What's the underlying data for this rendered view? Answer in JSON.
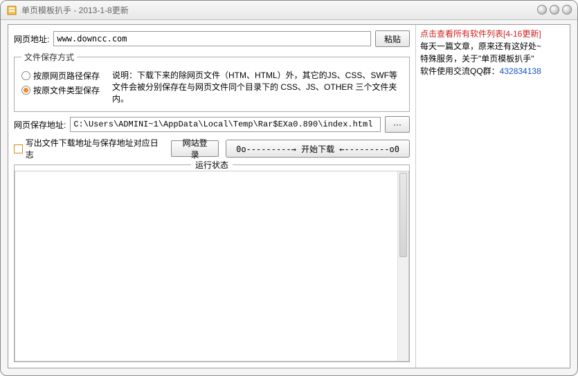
{
  "window": {
    "title": "单页模板扒手 - 2013-1-8更新"
  },
  "main": {
    "url_label": "网页地址:",
    "url_value": "www.downcc.com",
    "paste_btn": "粘贴",
    "save_group_title": "文件保存方式",
    "radio1": "按原网页路径保存",
    "radio2": "按原文件类型保存",
    "save_desc": "说明：下载下来的除网页文件（HTM、HTML）外，其它的JS、CSS、SWF等文件会被分别保存在与网页文件同个目录下的 CSS、JS、OTHER 三个文件夹内。",
    "savepath_label": "网页保存地址:",
    "savepath_value": "C:\\Users\\ADMINI~1\\AppData\\Local\\Temp\\Rar$EXa0.890\\index.html",
    "browse_btn": "···",
    "log_checkbox": "写出文件下载地址与保存地址对应日志",
    "site_login_btn": "网站登录",
    "start_btn": "0o---------→ 开始下载 ←---------o0",
    "status_group_title": "运行状态"
  },
  "side": {
    "link_text": "点击查看所有软件列表[4-16更新]",
    "line1": "每天一篇文章，原来还有这好处~",
    "line2_a": "特殊服务，关于\"",
    "line2_b": "单页模板扒手",
    "line2_c": "\"",
    "line3_a": "软件使用交流QQ群：",
    "line3_b": "432834138"
  }
}
